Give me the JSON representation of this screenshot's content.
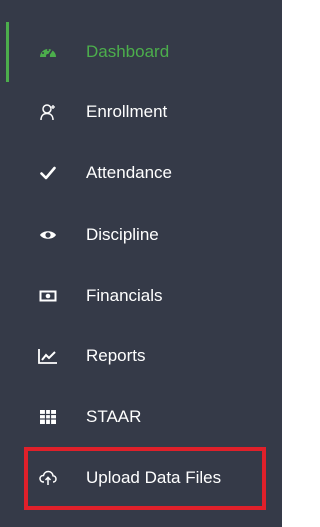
{
  "sidebar": {
    "accent_color": "#4cae4c",
    "background_color": "#353a48",
    "highlight_color": "#e0202a",
    "items": [
      {
        "label": "Dashboard",
        "icon": "dashboard-gauge-icon",
        "active": true
      },
      {
        "label": "Enrollment",
        "icon": "user-icon",
        "active": false
      },
      {
        "label": "Attendance",
        "icon": "checkmark-icon",
        "active": false
      },
      {
        "label": "Discipline",
        "icon": "eye-icon",
        "active": false
      },
      {
        "label": "Financials",
        "icon": "money-bill-icon",
        "active": false
      },
      {
        "label": "Reports",
        "icon": "line-chart-icon",
        "active": false
      },
      {
        "label": "STAAR",
        "icon": "table-grid-icon",
        "active": false
      },
      {
        "label": "Upload Data Files",
        "icon": "cloud-upload-icon",
        "active": false,
        "highlighted": true
      }
    ]
  }
}
